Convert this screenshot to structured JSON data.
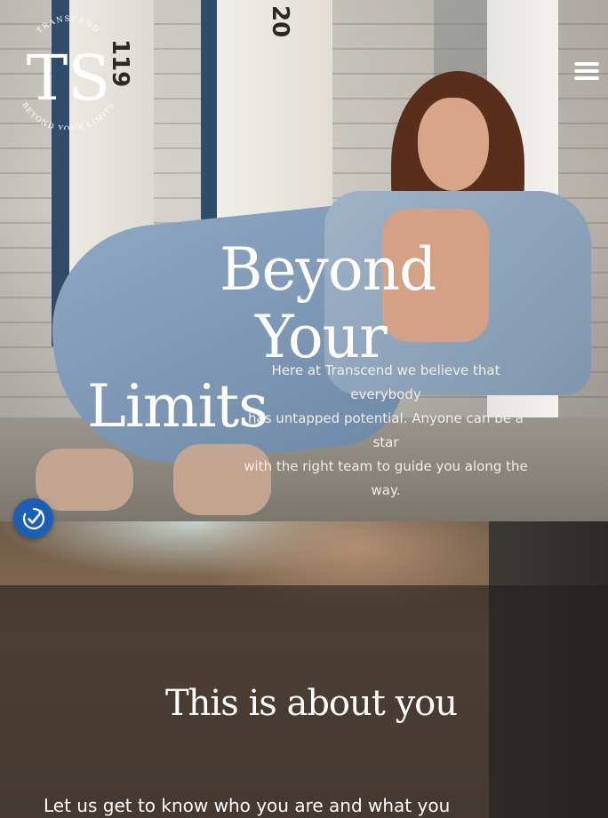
{
  "header": {
    "logo": {
      "top_text": "TRANSCEND",
      "monogram": "TS",
      "bottom_text": "BEYOND YOUR LIMITS"
    },
    "menu_icon": "hamburger-menu-icon"
  },
  "hero": {
    "door_numbers": {
      "left": "119",
      "right": "20"
    },
    "title_line1": "Beyond",
    "title_line2": "Your",
    "title_line3": "Limits",
    "text_line1": "Here at Transcend we believe that everybody",
    "text_line2": "has untapped potential. Anyone can be a star",
    "text_line3": "with the right team to guide you along the way."
  },
  "privacy_button": {
    "icon": "consent-check-icon",
    "color": "#1a5fb4"
  },
  "about": {
    "title": "This is about you",
    "text": "Let us get to know who you are and what you"
  }
}
